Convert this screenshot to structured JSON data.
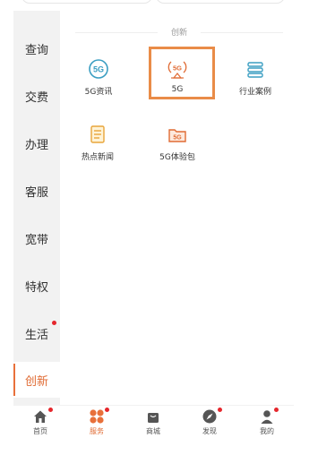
{
  "sidebar": {
    "items": [
      {
        "label": "查询"
      },
      {
        "label": "交费"
      },
      {
        "label": "办理"
      },
      {
        "label": "客服"
      },
      {
        "label": "宽带"
      },
      {
        "label": "特权"
      },
      {
        "label": "生活"
      },
      {
        "label": "创新"
      }
    ],
    "active": "创新"
  },
  "section": {
    "title": "创新",
    "items": [
      {
        "label": "5G资讯",
        "icon": "5g-news-icon"
      },
      {
        "label": "5G",
        "icon": "5g-signal-icon"
      },
      {
        "label": "行业案例",
        "icon": "industry-case-icon"
      },
      {
        "label": "热点新闻",
        "icon": "hot-news-icon"
      },
      {
        "label": "5G体验包",
        "icon": "5g-package-icon"
      }
    ]
  },
  "tabbar": {
    "tabs": [
      {
        "label": "首页",
        "icon": "home-icon"
      },
      {
        "label": "服务",
        "icon": "service-icon"
      },
      {
        "label": "商城",
        "icon": "mall-bag-icon"
      },
      {
        "label": "发现",
        "icon": "discover-compass-icon"
      },
      {
        "label": "我的",
        "icon": "profile-icon"
      }
    ],
    "active": "服务"
  },
  "colors": {
    "accent": "#e06b34",
    "highlight_border": "#e98c48",
    "badge_red": "#e5262c",
    "sidebar_bg": "#f2f2f2",
    "icon_teal": "#3b9ec2"
  }
}
